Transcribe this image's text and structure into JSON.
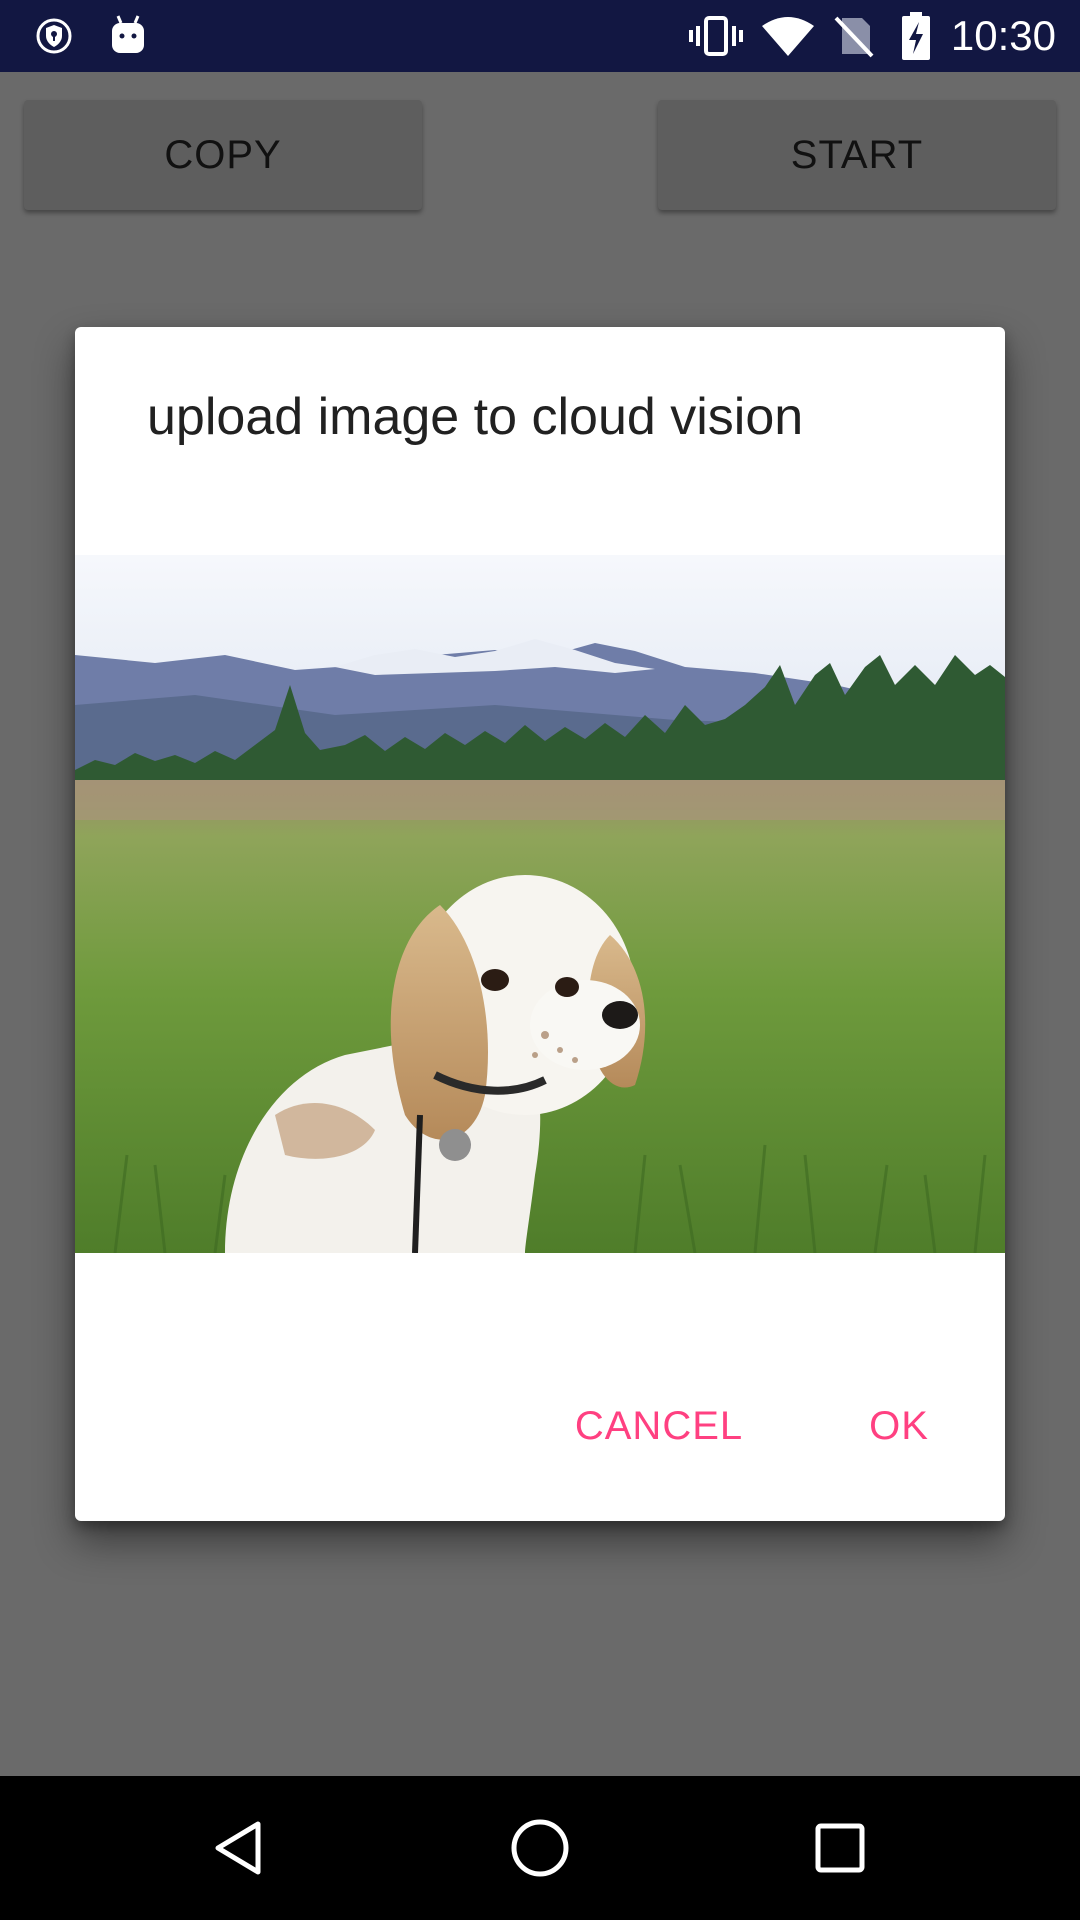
{
  "status_bar": {
    "time": "10:30",
    "background": "#121742",
    "icons": [
      "vpn-key-icon",
      "android-debug-icon",
      "vibrate-icon",
      "wifi-icon",
      "no-sim-icon",
      "battery-charging-icon"
    ]
  },
  "app": {
    "copy_button": "COPY",
    "start_button": "START",
    "background": "#6a6a6a"
  },
  "dialog": {
    "title": "upload image to cloud vision",
    "image_icon": "dog-in-meadow-photo",
    "cancel_button": "CANCEL",
    "ok_button": "OK",
    "accent": "#ff4081"
  },
  "nav_bar": {
    "icons": [
      "back-icon",
      "home-icon",
      "recents-icon"
    ]
  }
}
